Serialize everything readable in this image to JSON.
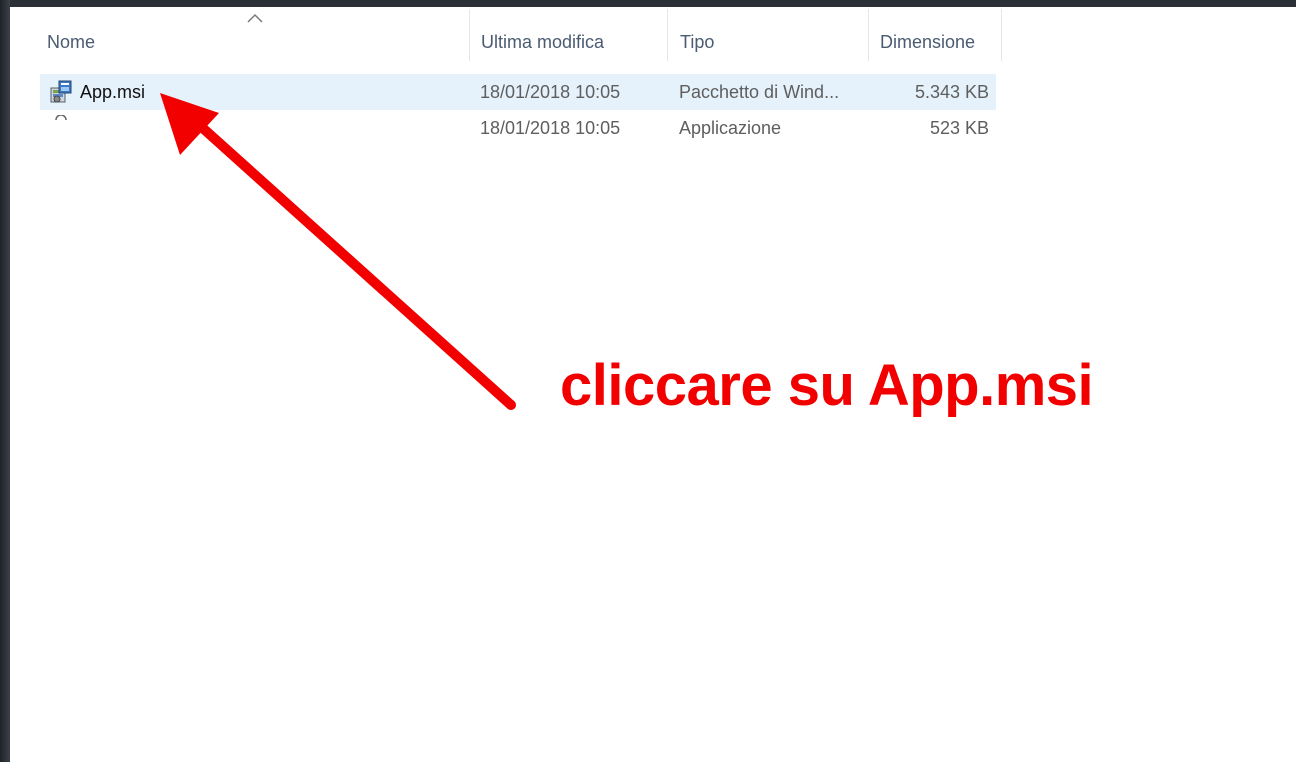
{
  "columns": {
    "name": "Nome",
    "modified": "Ultima modifica",
    "type": "Tipo",
    "size": "Dimensione"
  },
  "files": [
    {
      "name": "App.msi",
      "modified": "18/01/2018 10:05",
      "type": "Pacchetto di Wind...",
      "size": "5.343 KB",
      "icon": "msi-installer-icon",
      "selected": true
    },
    {
      "name": "",
      "modified": "18/01/2018 10:05",
      "type": "Applicazione",
      "size": "523 KB",
      "icon": "application-icon",
      "selected": false
    }
  ],
  "annotation": {
    "text": "cliccare su App.msi",
    "color": "#f20000"
  },
  "colors": {
    "selection": "#e6f2fb",
    "header_text": "#4a5b72"
  }
}
